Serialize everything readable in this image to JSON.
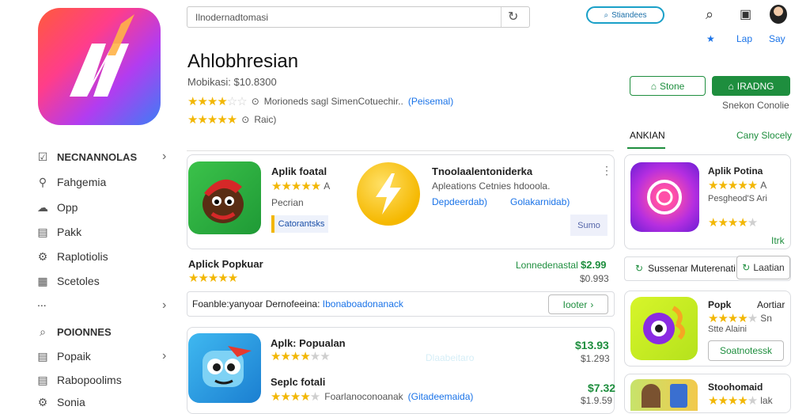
{
  "app": {
    "title": "Ahlobhresian",
    "price_line": "Mobikasi: $10.8300",
    "review_text": "Morioneds sagl SimenCotuechir..",
    "review_link": "(Peisemal)",
    "rating_label": "Raic)"
  },
  "search": {
    "value": "Ilnodernadtomasi"
  },
  "header": {
    "pill_label": "Stiandees",
    "star_label": "★",
    "lap_label": "Lap",
    "say_label": "Say",
    "green_outline_label": "Stone",
    "green_fill_label": "IRADNG",
    "under_button_text": "Snekon Conolie"
  },
  "sidebar": {
    "section1_header": "NECNANNOLAS",
    "items": [
      {
        "label": "Fahgemia",
        "icon": "pin-icon"
      },
      {
        "label": "Opp",
        "icon": "cloud-icon"
      },
      {
        "label": "Pakk",
        "icon": "chart-icon"
      },
      {
        "label": "Raplotiolis",
        "icon": "settings-icon"
      },
      {
        "label": "Scetoles",
        "icon": "grid-icon"
      }
    ],
    "more": "...",
    "section2_header": "POIONNES",
    "items2": [
      {
        "label": "Popaik",
        "icon": "chart-icon"
      },
      {
        "label": "Rabopoolims",
        "icon": "doc-icon"
      },
      {
        "label": "Sonia",
        "icon": "settings-icon"
      }
    ]
  },
  "tabs": {
    "active": "ANKIAN",
    "secondary": "Cany Slocely"
  },
  "main_cards": {
    "card1_title": "Aplik foatal",
    "card1_rating_suffix": "A",
    "card1_sub": "Pecrian",
    "card1_button": "Catorantsks",
    "card2_title": "Tnoolaalentoniderka",
    "card2_sub": "Apleations Cetnies hdooola.",
    "card2_link1": "Depdeerdab)",
    "card2_link2": "Golakarnidab)",
    "card2_button": "Sumo"
  },
  "row_popular": {
    "title": "Aplick Popkuar",
    "label_green": "Lonnedenastal",
    "price": "$2.99",
    "price_sub": "$0.993"
  },
  "search_strip": {
    "text": "Foanble:yanyoar Dernofeeina:",
    "link": "Ibonaboadonanack",
    "button": "Iooter"
  },
  "bottom_card": {
    "title": "Aplk: Popualan",
    "faint": "Dlaabeitaro",
    "price": "$13.93",
    "price_sub": "$1.293",
    "title2": "Seplc fotali",
    "row2_text": "Foarlanoconoanak",
    "row2_link": "(Gitadeemaida)",
    "price2": "$7.32",
    "price2_sub": "$1.9.59"
  },
  "right_col": {
    "card1_title": "Aplik Potina",
    "card1_sub": "Pesgheod'S Ari",
    "card1_rating_suffix": "A",
    "card1_sub2": "Itrk",
    "strip_text": "Sussenar Muterenati",
    "strip_button": "Laatian",
    "card2_title": "Popk",
    "card2_title_b": "Aortiar",
    "card2_sub": "Stte Alaini",
    "card2_rating_suffix": "Sn",
    "card2_button": "Soatnotessk",
    "card3_title": "Stoohomaid",
    "card3_rating_suffix": "lak"
  },
  "colors": {
    "brand_green": "#1e8e3e",
    "link_blue": "#1a73e8",
    "star": "#f2b705"
  }
}
